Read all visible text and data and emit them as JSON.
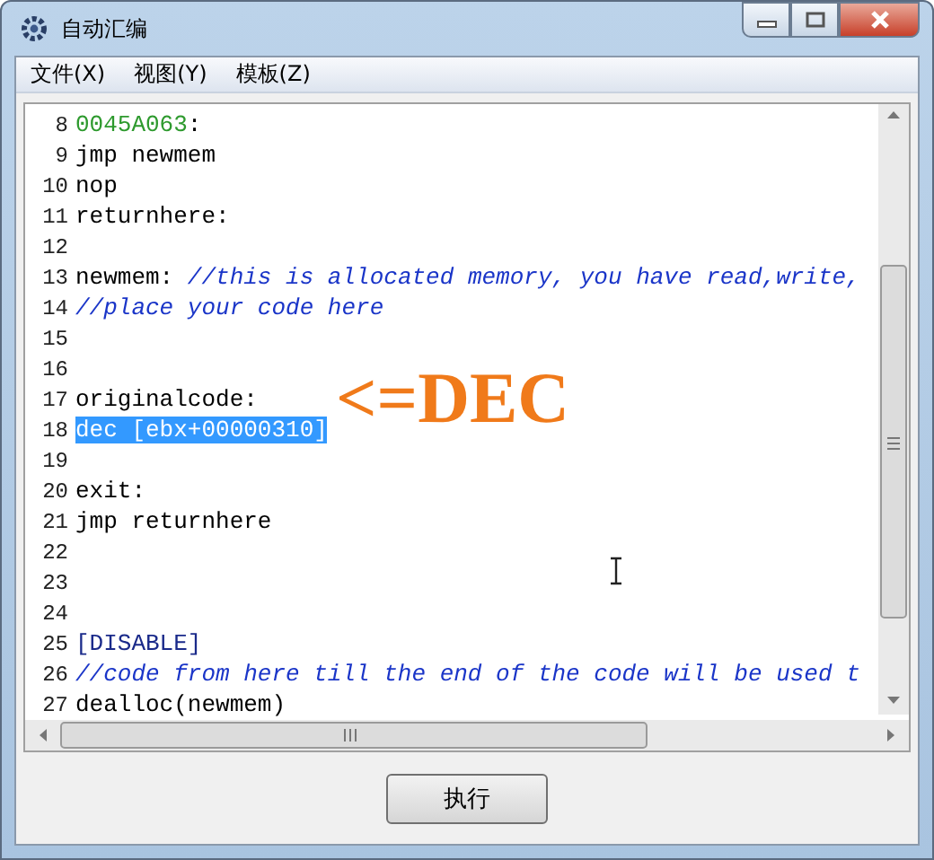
{
  "window": {
    "title": "自动汇编"
  },
  "menu": [
    {
      "label": "文件(X)"
    },
    {
      "label": "视图(Y)"
    },
    {
      "label": "模板(Z)"
    }
  ],
  "editor": {
    "lines": [
      {
        "number": "8",
        "segments": [
          {
            "kind": "address",
            "text": "0045A063"
          },
          {
            "kind": "plain",
            "text": ":"
          }
        ]
      },
      {
        "number": "9",
        "segments": [
          {
            "kind": "plain",
            "text": "jmp newmem"
          }
        ]
      },
      {
        "number": "10",
        "segments": [
          {
            "kind": "plain",
            "text": "nop"
          }
        ]
      },
      {
        "number": "11",
        "segments": [
          {
            "kind": "plain",
            "text": "returnhere:"
          }
        ]
      },
      {
        "number": "12"
      },
      {
        "number": "13",
        "segments": [
          {
            "kind": "plain",
            "text": "newmem: "
          },
          {
            "kind": "comment",
            "text": "//this is allocated memory, you have read,write,"
          }
        ]
      },
      {
        "number": "14",
        "segments": [
          {
            "kind": "comment",
            "text": "//place your code here"
          }
        ]
      },
      {
        "number": "15"
      },
      {
        "number": "16"
      },
      {
        "number": "17",
        "segments": [
          {
            "kind": "plain",
            "text": "originalcode:"
          }
        ]
      },
      {
        "number": "18",
        "segments": [
          {
            "kind": "selection",
            "text": "dec [ebx+00000310]"
          }
        ]
      },
      {
        "number": "19"
      },
      {
        "number": "20",
        "segments": [
          {
            "kind": "plain",
            "text": "exit:"
          }
        ]
      },
      {
        "number": "21",
        "segments": [
          {
            "kind": "plain",
            "text": "jmp returnhere"
          }
        ]
      },
      {
        "number": "22"
      },
      {
        "number": "23"
      },
      {
        "number": "24"
      },
      {
        "number": "25",
        "segments": [
          {
            "kind": "section",
            "text": "[DISABLE]"
          }
        ]
      },
      {
        "number": "26",
        "segments": [
          {
            "kind": "comment",
            "text": "//code from here till the end of the code will be used t"
          }
        ]
      },
      {
        "number": "27",
        "segments": [
          {
            "kind": "plain",
            "text": "dealloc(newmem)"
          }
        ]
      }
    ]
  },
  "annotation": "<=DEC",
  "execute_button": "执行"
}
